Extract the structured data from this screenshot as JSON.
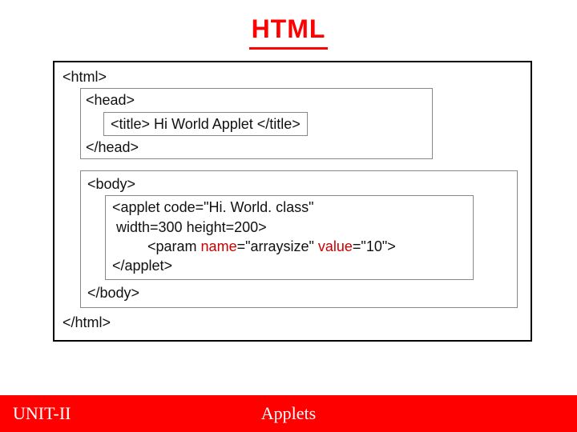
{
  "title": "HTML",
  "code": {
    "html_open": "<html>",
    "head_open": "<head>",
    "title_line": "<title> Hi World Applet </title>",
    "head_close": "</head>",
    "body_open": "<body>",
    "applet_open": "<applet code=\"Hi. World. class\"",
    "applet_dims": " width=300 height=200>",
    "param_prefix": "<param ",
    "param_name_attr": "name",
    "param_name_val": "=\"arraysize\" ",
    "param_value_attr": "value",
    "param_value_val": "=\"10\">",
    "applet_close": "</applet>",
    "body_close": "</body>",
    "html_close": "</html>"
  },
  "footer": {
    "left": "UNIT-II",
    "center": "Applets"
  }
}
